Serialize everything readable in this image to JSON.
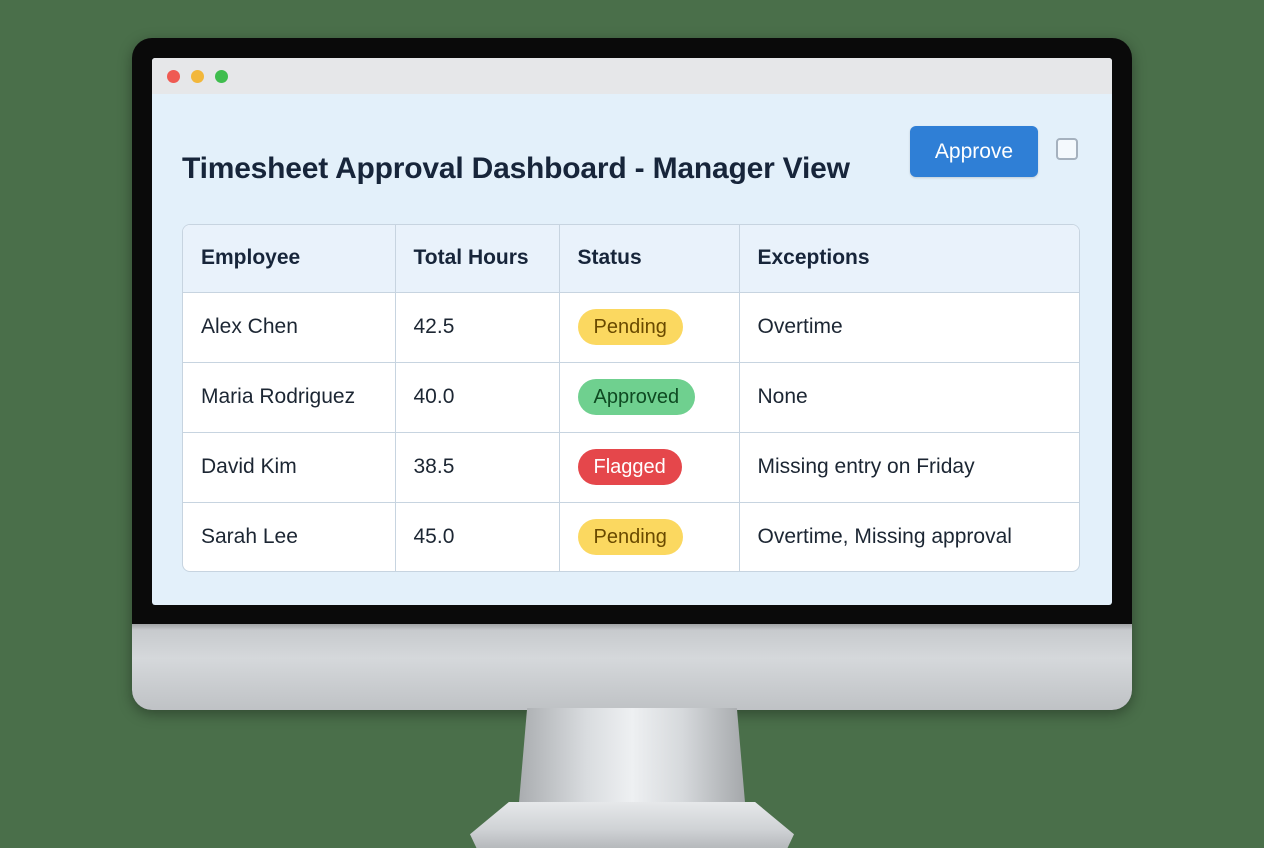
{
  "window": {
    "controls": [
      "close",
      "minimize",
      "maximize"
    ]
  },
  "header": {
    "title": "Timesheet Approval Dashboard - Manager View",
    "approve_label": "Approve",
    "select_all_checked": false
  },
  "table": {
    "columns": [
      "Employee",
      "Total Hours",
      "Status",
      "Exceptions"
    ],
    "rows": [
      {
        "employee": "Alex Chen",
        "hours": "42.5",
        "status": "Pending",
        "exceptions": "Overtime"
      },
      {
        "employee": "Maria Rodriguez",
        "hours": "40.0",
        "status": "Approved",
        "exceptions": "None"
      },
      {
        "employee": "David Kim",
        "hours": "38.5",
        "status": "Flagged",
        "exceptions": "Missing entry on Friday"
      },
      {
        "employee": "Sarah Lee",
        "hours": "45.0",
        "status": "Pending",
        "exceptions": "Overtime, Missing approval"
      }
    ]
  },
  "colors": {
    "accent": "#2f7fd6",
    "status": {
      "Pending": {
        "bg": "#fbd860",
        "fg": "#6a4a00"
      },
      "Approved": {
        "bg": "#6fd08f",
        "fg": "#0e4a22"
      },
      "Flagged": {
        "bg": "#e5474b",
        "fg": "#ffffff"
      }
    }
  }
}
